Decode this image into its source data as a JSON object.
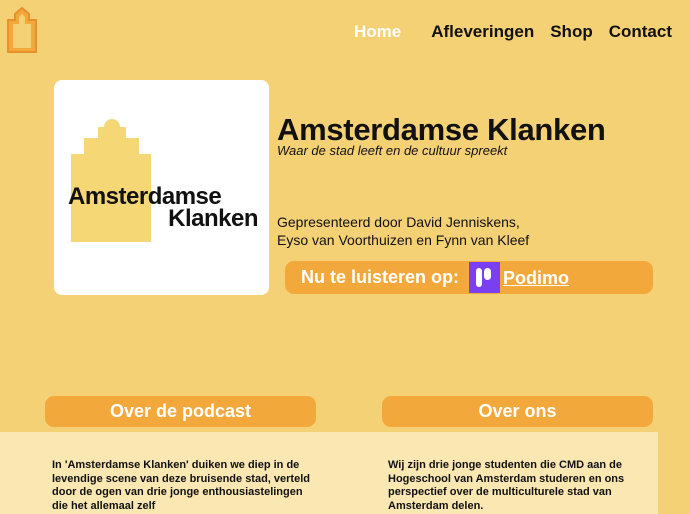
{
  "nav": {
    "items": [
      {
        "label": "Home",
        "active": true
      },
      {
        "label": "Afleveringen",
        "active": false
      },
      {
        "label": "Shop",
        "active": false
      },
      {
        "label": "Contact",
        "active": false
      }
    ]
  },
  "logo": {
    "icon": "house-icon",
    "color": "#f3a83b"
  },
  "cover": {
    "line1": "Amsterdamse",
    "line2": "Klanken",
    "accent": "#f5d776"
  },
  "hero": {
    "title": "Amsterdamse Klanken",
    "tagline": "Waar de stad leeft en de cultuur spreekt",
    "hosts_line1": "Gepresenteerd door David Jenniskens,",
    "hosts_line2": "Eyso van Voorthuizen en Fynn van Kleef"
  },
  "listen": {
    "label": "Nu te luisteren op:",
    "platform": "Podimo",
    "platform_icon": "podimo-icon",
    "platform_color": "#7a3ff0"
  },
  "sections": {
    "podcast_title": "Over de podcast",
    "podcast_text": "In 'Amsterdamse Klanken' duiken we diep in de levendige scene van deze bruisende stad, verteld door de ogen van drie jonge enthousiastelingen die het allemaal zelf",
    "us_title": "Over ons",
    "us_text": "Wij zijn drie jonge studenten die CMD aan de Hogeschool van Amsterdam studeren en ons perspectief over de multiculturele stad van Amsterdam delen."
  },
  "colors": {
    "background": "#f5d176",
    "accent": "#f3a83b",
    "panel": "#fae7b2"
  }
}
